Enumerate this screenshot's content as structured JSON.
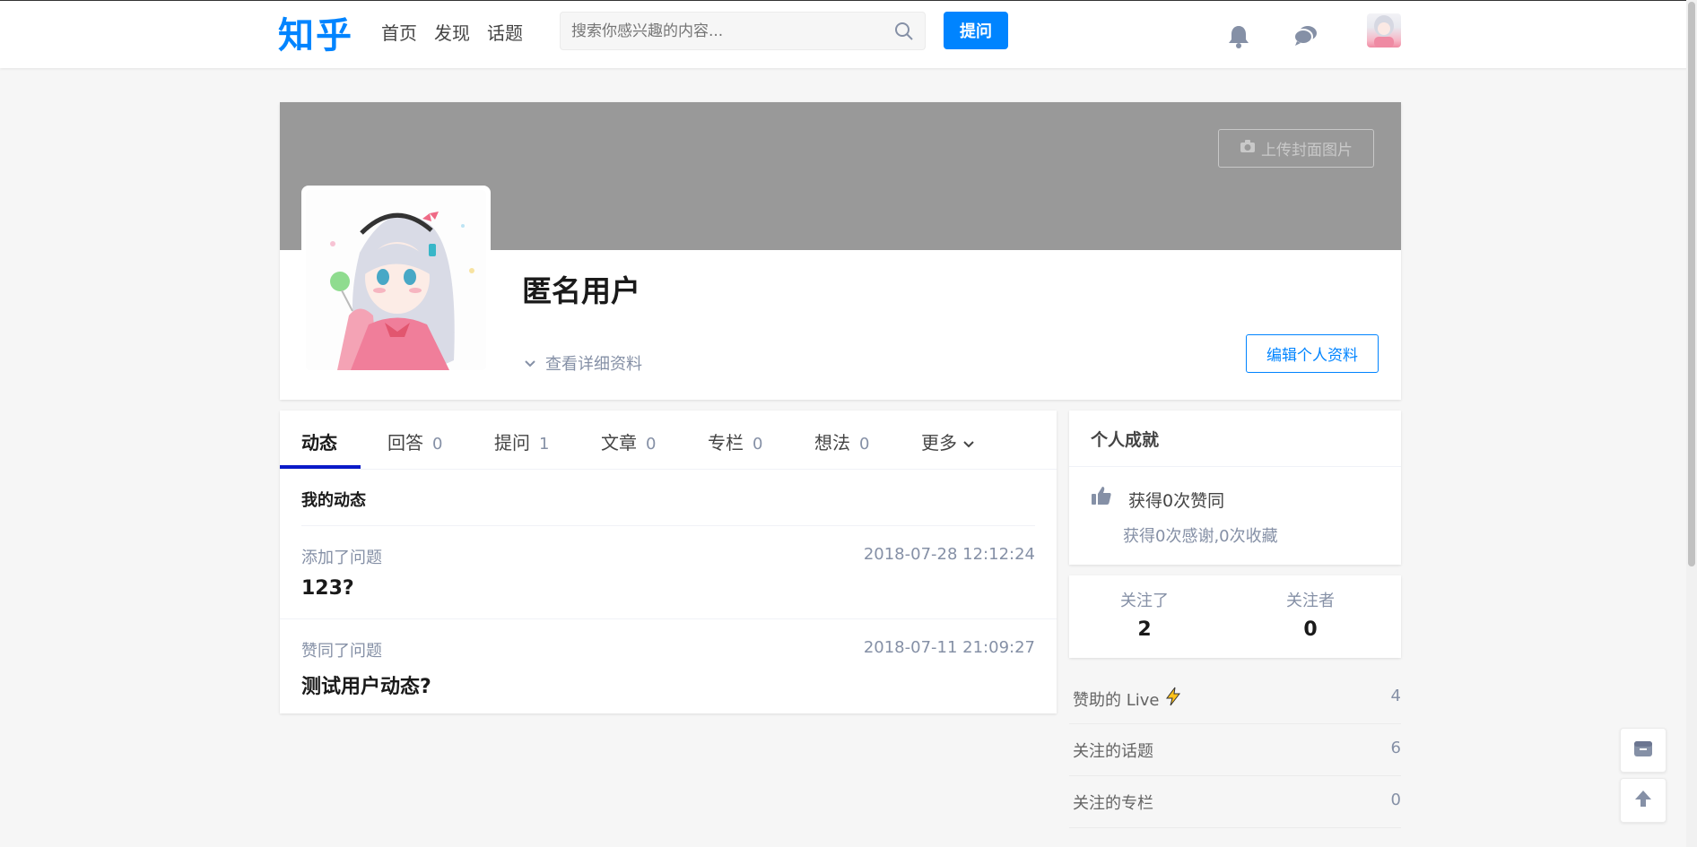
{
  "header": {
    "logo": "知乎",
    "nav": [
      "首页",
      "发现",
      "话题"
    ],
    "search_placeholder": "搜索你感兴趣的内容...",
    "ask_label": "提问",
    "icons": [
      "bell-icon",
      "chat-icon"
    ]
  },
  "profile": {
    "upload_cover_label": "上传封面图片",
    "name": "匿名用户",
    "detail_link": "查看详细资料",
    "edit_label": "编辑个人资料"
  },
  "tabs": [
    {
      "label": "动态",
      "count": ""
    },
    {
      "label": "回答",
      "count": "0"
    },
    {
      "label": "提问",
      "count": "1"
    },
    {
      "label": "文章",
      "count": "0"
    },
    {
      "label": "专栏",
      "count": "0"
    },
    {
      "label": "想法",
      "count": "0"
    },
    {
      "label": "更多",
      "count": ""
    }
  ],
  "activity": {
    "section_title": "我的动态",
    "items": [
      {
        "action": "添加了问题",
        "time": "2018-07-28 12:12:24",
        "title": "123?"
      },
      {
        "action": "赞同了问题",
        "time": "2018-07-11 21:09:27",
        "title": "测试用户动态?"
      }
    ]
  },
  "achievements": {
    "title": "个人成就",
    "line1": "获得0次赞同",
    "line2": "获得0次感谢,0次收藏"
  },
  "follow": {
    "following_label": "关注了",
    "following_count": "2",
    "followers_label": "关注者",
    "followers_count": "0"
  },
  "side_list": [
    {
      "label": "赞助的 Live",
      "value": "4"
    },
    {
      "label": "关注的话题",
      "value": "6"
    },
    {
      "label": "关注的专栏",
      "value": "0"
    }
  ],
  "colors": {
    "brand": "#0084ff",
    "tab_active": "#0a1ac8",
    "cover": "#999999"
  }
}
